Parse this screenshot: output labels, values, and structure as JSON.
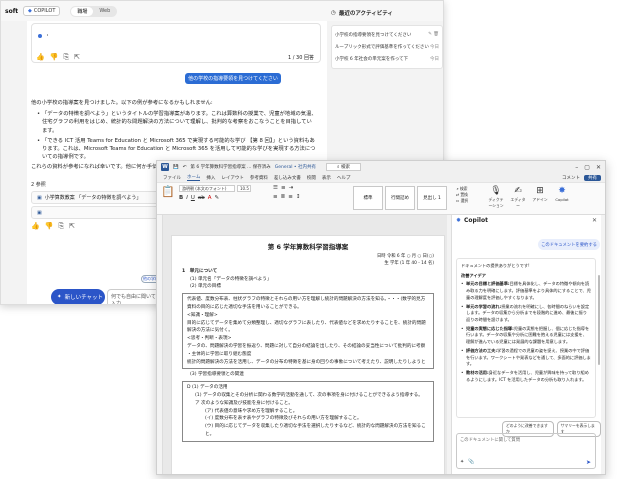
{
  "back": {
    "brand": "soft",
    "copilot_chip": "COPILOT",
    "seg": [
      "職場",
      "Web"
    ],
    "top_card_line": "・",
    "pager": "1 / 30 回答",
    "user_message": "他の学校の指導要領を見つけてください",
    "answer_intro": "他の小学校の指導案を見つけました。以下の例が参考になるかもしれません:",
    "answer_items": [
      "「データの特徴を調べよう」というタイトルの学習指導案があります。これは算数科の授業で、児童が地域の気温、住宅グラフの利用をはじめ、統計的な問題解決の方法について理解し、批判的な考察をおこなうことを目指しています。",
      "「できる ICT 活用 Teams for Education と Microsoft 365 で実現する可能的な学び 【第 8 回】」という資料もあります。これは、Microsoft Teams for Education と Microsoft 365 を活用して可能的な学びを実現する方法についての指導例です。"
    ],
    "answer_tail": "これらの資料が参考になれば幸いです。他に何か手伝",
    "refs_title": "2 参照",
    "refs": [
      "小学算数教案 「データの特徴を調べよう」",
      ""
    ],
    "suggest_btn": "他の学校の指導要領",
    "new_chat": "新しいチャット",
    "input_placeholder": "何でも自由に聞いてね。「/」を入力",
    "activity_title": "最近のアクティビティ",
    "activity_items": [
      "小学校の指導要領を見つけてください",
      "ループリック形式で評価基準を作ってください",
      "小学校 6 年社会の単元案を作って下"
    ],
    "activity_icons": [
      "✎ 🗑",
      "今日",
      "今日"
    ]
  },
  "word": {
    "title": "第 6 学年算数科学習指導案 ... 保存済み",
    "label_general": "General • 社内共有",
    "search_placeholder": "検索",
    "tabs": [
      "ファイル",
      "ホーム",
      "挿入",
      "レイアウト",
      "参考資料",
      "差し込み文書",
      "校閲",
      "表示",
      "ヘルプ"
    ],
    "share": "共有",
    "comments": "コメント",
    "ribbon": {
      "font": "游明朝 (本文のフォント)",
      "size": "10.5",
      "style1": "標準",
      "style2": "行間詰め",
      "style3": "見出し 1",
      "find": "検索",
      "replace": "置換",
      "select": "選択",
      "dictate": "ディクテーション",
      "editor": "エディター",
      "addins": "アドイン",
      "copilot": "Copilot"
    },
    "doc": {
      "title": "第 6 学年算数科学習指導案",
      "meta1": "日時 令和 6 年 ○ 月 ○ 日(○)",
      "meta2": "生 学年 (1 年 40 - 14 名)",
      "sec1": "1　単元について",
      "sec1a": "(1) 単元名「データの特徴を調べよう」",
      "sec1b": "(2) 単元の目標",
      "box1": [
        "代表値、度数分布表、柱状グラフの特徴とそれらの用い方を理解し統計的問題解決の方法を知る。・・・(数学的見方",
        "資料の目的に応じた適切な手法を用いることができる。",
        "<知識・理解>",
        "目的に応じてデータを集めて分類整理し、適切なグラフに表したり、代表値などを求めたりすることを、統計的問題",
        "解決の方法に気付く。",
        "<思考・判断・表現>",
        "データの、問題解決の学習を振返り、問題に対して自分の結論を出したり、その結論の妥当性について批判的に考察",
        "・主体的に学習に取り組む態度",
        "統計的問題解決の方法を活用し、データの分布の特徴を基に身の回りの事象について考えたり、説明したりしようと"
      ],
      "sec2": "(3) 学習指導要領との関連",
      "box2": [
        "D (1) データの活用",
        "(1) データの収集とその分析に関わる数学的活動を通して、次の事項を身に付けることができるよう指導する。",
        "ア 次のような知識及び技能を身に付けること。",
        "(ア) 代表値の意味や求め方を理解すること。",
        "(イ) 度数分布を表す表やグラフの特徴及びそれらの用い方を理解すること。",
        "(ウ) 目的に応じてデータを収集したり適切な手法を選択したりするなど、統計的な問題解決の方法を知ること。"
      ]
    }
  },
  "copilot": {
    "title": "Copilot",
    "summarize": "このドキュメントを要約する",
    "lead": "ドキュメントの提供ありがとうです!",
    "sub": "改善アイデア",
    "items": [
      {
        "b": "単元の目標と評価基準:",
        "t": "目標を具体化し、データの特徴や傾向を読み取る力を明確にします。評価基準をより具体的にすることで、児童の理解度を評価しやすくなります。"
      },
      {
        "b": "単元の学習の流れ:",
        "t": "授業の流れを明確にし、各時間のねらいを設定します。データの収集から分析までを段階的に進め、最後に振り返りの時間を設けます。"
      },
      {
        "b": "児童の実態に応じた指導:",
        "t": "児童の実態を把握し、個に応じた指導を行います。データの収集や分析に困難を抱える児童には支援を、理解が進んでいる児童には発展的な課題を用意します。"
      },
      {
        "b": "評価方法の工夫:",
        "t": "学習の過程での児童の姿を捉え、授業の中で評価を行います。ワークシートや発表などを通して、多面的に評価します。"
      },
      {
        "b": "教材の活用:",
        "t": "身近なデータを活用し、児童が興味を持って取り組めるようにします。ICT を活用したデータの分析も取り入れます。"
      }
    ],
    "btn1": "どのように改善できますか",
    "btn2": "サマリーを表示します",
    "input_placeholder": "このドキュメントに関して質問"
  }
}
